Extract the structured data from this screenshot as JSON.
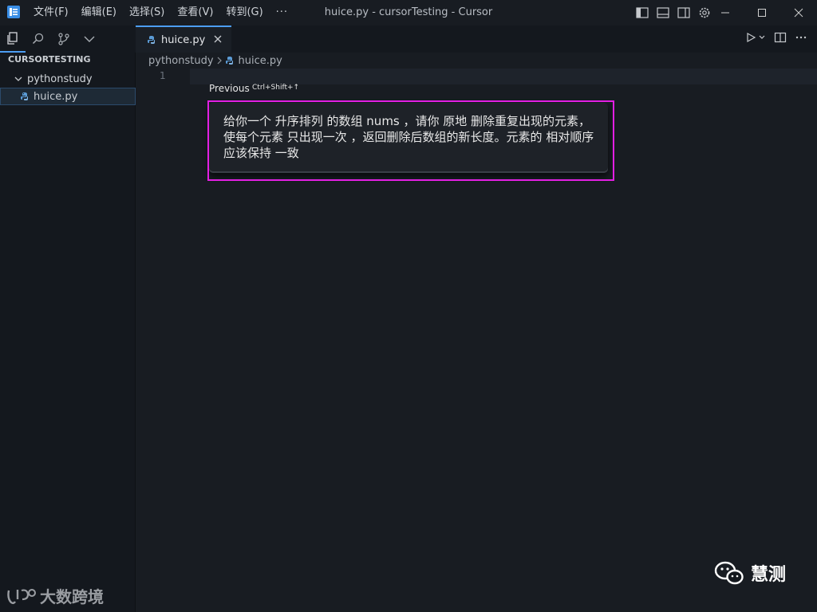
{
  "titlebar": {
    "window_title": "huice.py - cursorTesting - Cursor",
    "menu": [
      "文件(F)",
      "编辑(E)",
      "选择(S)",
      "查看(V)",
      "转到(G)"
    ],
    "more": "···"
  },
  "sidebar": {
    "title": "CURSORTESTING",
    "folder": "pythonstudy",
    "file": "huice.py"
  },
  "tabs": [
    {
      "label": "huice.py"
    }
  ],
  "breadcrumb": {
    "folder": "pythonstudy",
    "file": "huice.py"
  },
  "editor": {
    "line_number": "1"
  },
  "prompt": {
    "previous_label": "Previous",
    "previous_shortcut": "Ctrl+Shift+↑",
    "text": "给你一个 升序排列 的数组 nums ，请你 原地 删除重复出现的元素，使每个元素 只出现一次 ，返回删除后数组的新长度。元素的 相对顺序 应该保持 一致"
  },
  "watermarks": {
    "left": "大数跨境",
    "right": "慧测"
  },
  "colors": {
    "accent": "#4c9df3",
    "highlight": "#e31fe3",
    "python_icon": "#5b9bd5"
  }
}
